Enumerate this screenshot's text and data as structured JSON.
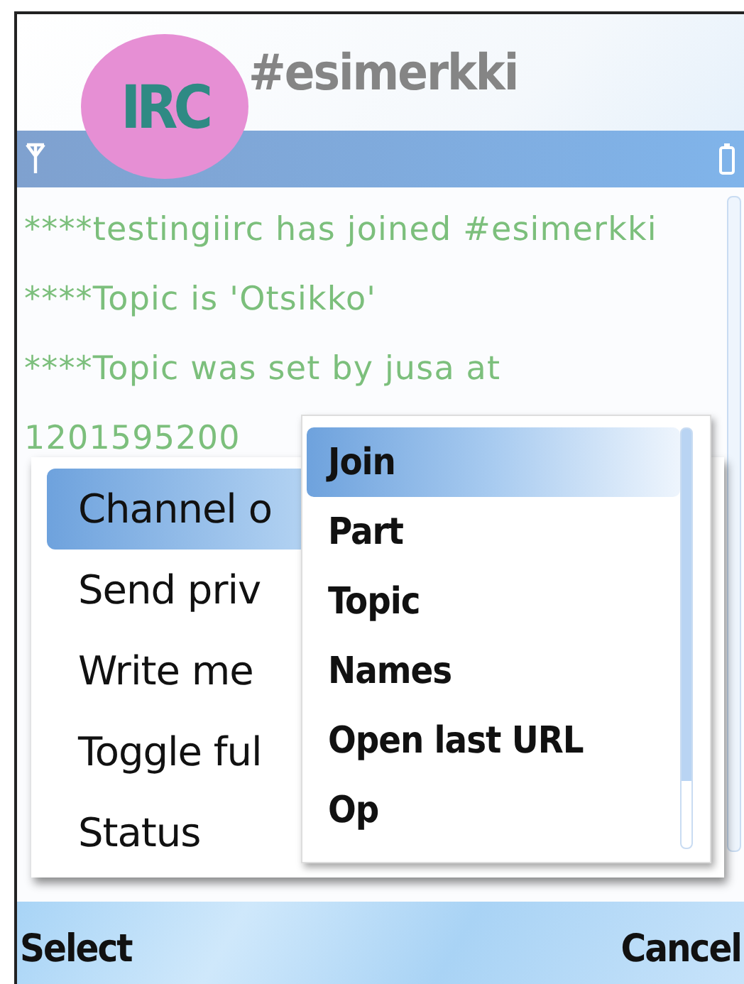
{
  "title": "#esimerkki",
  "logo": {
    "text": "IRC"
  },
  "messages": [
    "****testingiirc has joined #esimerkki",
    "****Topic is 'Otsikko'",
    "****Topic was set by jusa at",
    "1201595200"
  ],
  "menu": {
    "items": [
      {
        "label": "Channel o",
        "selected": true
      },
      {
        "label": "Send priv",
        "selected": false
      },
      {
        "label": "Write me",
        "selected": false
      },
      {
        "label": "Toggle ful",
        "selected": false
      },
      {
        "label": "Status",
        "selected": false
      }
    ]
  },
  "submenu": {
    "items": [
      {
        "label": "Join",
        "selected": true
      },
      {
        "label": "Part",
        "selected": false
      },
      {
        "label": "Topic",
        "selected": false
      },
      {
        "label": "Names",
        "selected": false
      },
      {
        "label": "Open last URL",
        "selected": false
      },
      {
        "label": "Op",
        "selected": false
      }
    ]
  },
  "softkeys": {
    "left": "Select",
    "right": "Cancel"
  }
}
